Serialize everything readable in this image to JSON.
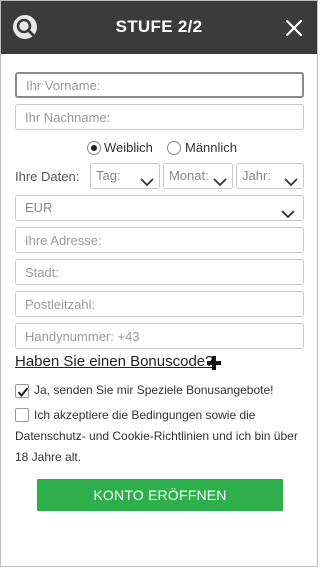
{
  "header": {
    "title": "STUFE 2/2",
    "logo_icon": "search-chat-logo-icon",
    "close_icon": "close-icon",
    "background": "#3b3b3b"
  },
  "form": {
    "first_name_placeholder": "Ihr Vorname:",
    "last_name_placeholder": "Ihr Nachname:",
    "gender": {
      "options": [
        "Weiblich",
        "Männlich"
      ],
      "selected": "Weiblich"
    },
    "date_label": "Ihre Daten:",
    "day_placeholder": "Tag:",
    "month_placeholder": "Monat:",
    "year_placeholder": "Jahr:",
    "currency_value": "EUR",
    "address_placeholder": "Ihre Adresse:",
    "city_placeholder": "Stadt:",
    "postal_placeholder": "Postleitzahl:",
    "phone_placeholder": "Handynummer: +43",
    "bonus_code_link": "Haben Sie einen Bonuscode?",
    "offers_checkbox": {
      "label": "Ja, senden Sie mir Speziele Bonusangebote!",
      "checked": true
    },
    "terms_checkbox": {
      "lines": [
        "Ich akzeptiere die Bedingungen sowie die",
        "Datenschutz- und Cookie-Richtlinien und ich bin über",
        "18 Jahre alt."
      ],
      "checked": false
    },
    "submit_label": "KONTO ERÖFFNEN",
    "accent_color": "#2db04b"
  }
}
